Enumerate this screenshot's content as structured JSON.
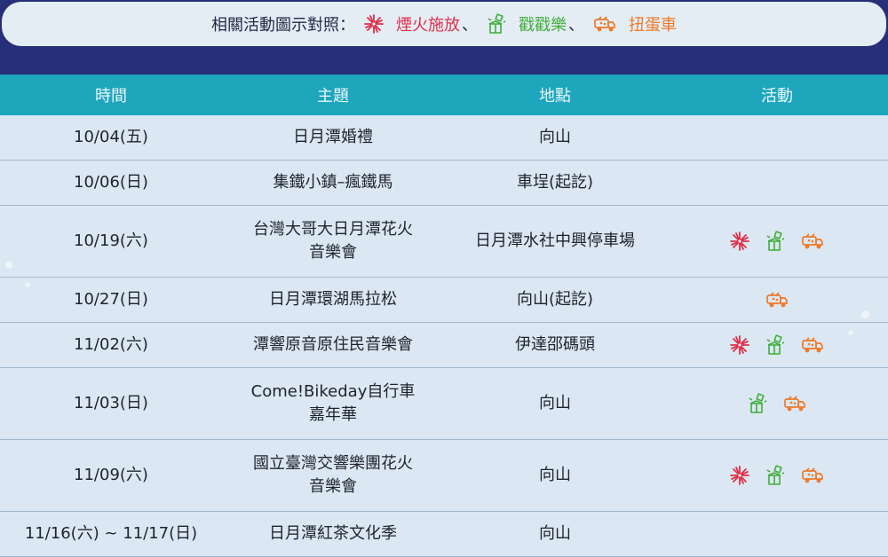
{
  "legend": {
    "prefix": "相關活動圖示對照：",
    "fireworks": "煙火施放",
    "sep1": "、",
    "gift": "戳戳樂",
    "sep2": "、",
    "truck": "扭蛋車"
  },
  "table": {
    "headers": [
      "時間",
      "主題",
      "地點",
      "活動"
    ],
    "rows": [
      {
        "time": "10/04(五)",
        "topic": [
          "日月潭婚禮"
        ],
        "place": "向山",
        "icons": [],
        "height": 51
      },
      {
        "time": "10/06(日)",
        "topic": [
          "集鐵小鎮–瘋鐵馬"
        ],
        "place": "車埕(起訖)",
        "icons": [],
        "height": 51
      },
      {
        "time": "10/19(六)",
        "topic": [
          "台灣大哥大日月潭花火",
          "音樂會"
        ],
        "place": "日月潭水社中興停車場",
        "icons": [
          "fireworks-icon",
          "gift-icon",
          "truck-icon"
        ],
        "height": 81
      },
      {
        "time": "10/27(日)",
        "topic": [
          "日月潭環湖馬拉松"
        ],
        "place": "向山(起訖)",
        "icons": [
          "truck-icon"
        ],
        "height": 51
      },
      {
        "time": "11/02(六)",
        "topic": [
          "潭響原音原住民音樂會"
        ],
        "place": "伊達邵碼頭",
        "icons": [
          "fireworks-icon",
          "gift-icon",
          "truck-icon"
        ],
        "height": 51
      },
      {
        "time": "11/03(日)",
        "topic": [
          "Come!Bikeday自行車",
          "嘉年華"
        ],
        "place": "向山",
        "icons": [
          "gift-icon",
          "truck-icon"
        ],
        "height": 81
      },
      {
        "time": "11/09(六)",
        "topic": [
          "國立臺灣交響樂團花火",
          "音樂會"
        ],
        "place": "向山",
        "icons": [
          "fireworks-icon",
          "gift-icon",
          "truck-icon"
        ],
        "height": 81
      },
      {
        "time": "11/16(六) ~ 11/17(日)",
        "topic": [
          "日月潭紅茶文化季"
        ],
        "place": "向山",
        "icons": [],
        "height": 51
      }
    ]
  },
  "colors": {
    "fireworks": "#e0304a",
    "gift": "#3fae3a",
    "truck": "#ef7a2a",
    "header": "#1ea6bd",
    "banner": "#262f78"
  }
}
